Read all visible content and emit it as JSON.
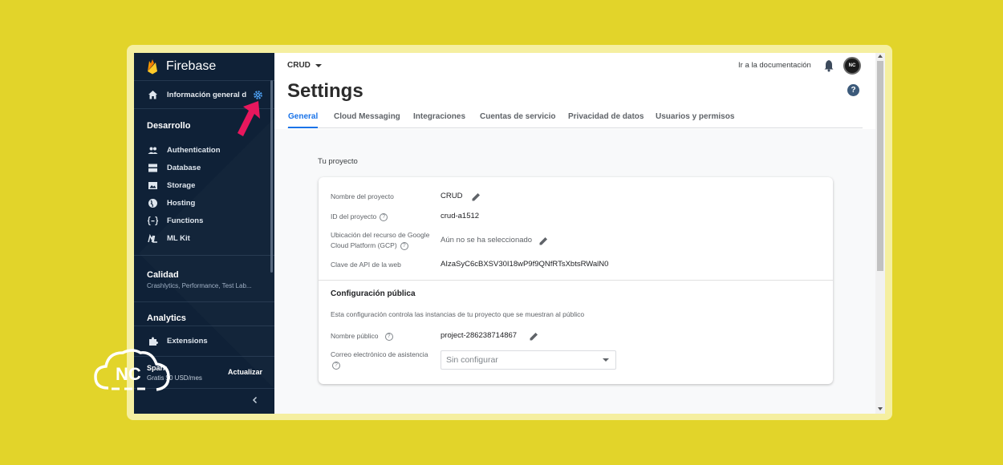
{
  "sidebar": {
    "brand": "Firebase",
    "home_label": "Información general del proyecto",
    "sections": {
      "develop": "Desarrollo",
      "quality": "Calidad",
      "quality_sub": "Crashlytics, Performance, Test Lab...",
      "analytics": "Analytics"
    },
    "items": [
      {
        "label": "Authentication",
        "icon": "people-icon"
      },
      {
        "label": "Database",
        "icon": "database-icon"
      },
      {
        "label": "Storage",
        "icon": "image-icon"
      },
      {
        "label": "Hosting",
        "icon": "globe-icon"
      },
      {
        "label": "Functions",
        "icon": "functions-icon"
      },
      {
        "label": "ML Kit",
        "icon": "ml-kit-icon"
      }
    ],
    "extensions_label": "Extensions",
    "plan_name": "Spark",
    "plan_price": "Gratis $0 USD/mes",
    "upgrade_label": "Actualizar"
  },
  "header": {
    "project": "CRUD",
    "docs_link": "Ir a la documentación",
    "avatar_text": "NC"
  },
  "page": {
    "title": "Settings",
    "tabs": [
      {
        "label": "General",
        "active": true
      },
      {
        "label": "Cloud Messaging",
        "active": false
      },
      {
        "label": "Integraciones",
        "active": false
      },
      {
        "label": "Cuentas de servicio",
        "active": false
      },
      {
        "label": "Privacidad de datos",
        "active": false
      },
      {
        "label": "Usuarios y permisos",
        "active": false
      }
    ]
  },
  "project_card": {
    "section_label": "Tu proyecto",
    "rows": [
      {
        "label": "Nombre del proyecto",
        "value": "CRUD"
      },
      {
        "label": "ID del proyecto",
        "value": "crud-a1512"
      },
      {
        "label": "Ubicación del recurso de Google Cloud Platform (GCP)",
        "value": "Aún no se ha seleccionado"
      },
      {
        "label": "Clave de API de la web",
        "value": "AIzaSyC6cBXSV30I18wP9f9QNfRTsXbtsRWalN0"
      }
    ],
    "public_title": "Configuración pública",
    "public_desc": "Esta configuración controla las instancias de tu proyecto que se muestran al público",
    "public_name_label": "Nombre público",
    "public_name_value": "project-286238714867",
    "support_email_label": "Correo electrónico de asistencia",
    "support_email_placeholder": "Sin configurar"
  },
  "watermark": "NC",
  "colors": {
    "sidebar_bg": "#0f2137",
    "accent": "#1a73e8",
    "highlight_arrow": "#e8175d",
    "page_bg": "#e2d42a"
  }
}
